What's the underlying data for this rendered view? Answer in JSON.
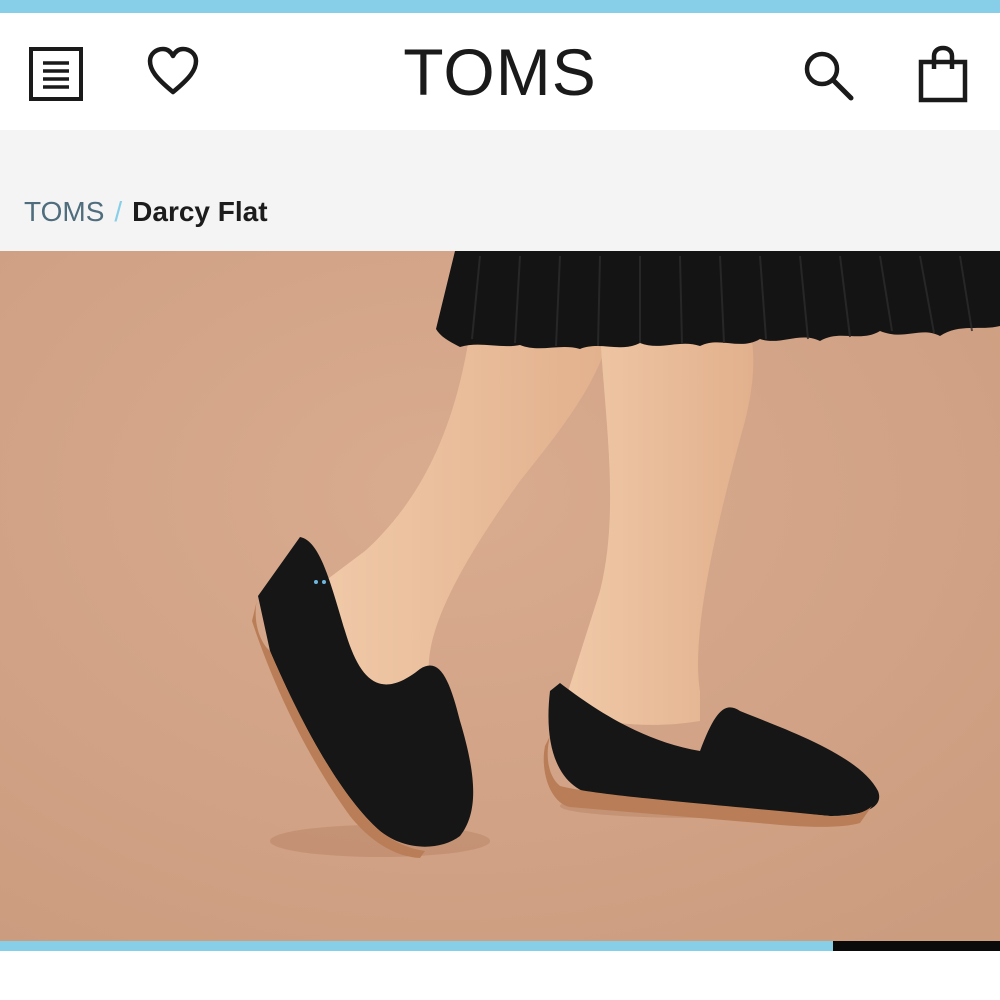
{
  "header": {
    "brand": "TOMS",
    "icons": {
      "menu": "menu-list-icon",
      "wishlist": "heart-icon",
      "search": "search-icon",
      "bag": "shopping-bag-icon"
    }
  },
  "breadcrumb": {
    "home": "TOMS",
    "separator": "/",
    "current": "Darcy Flat"
  },
  "hero": {
    "image": "Woman wearing black Darcy Flat shoes on a tan background"
  },
  "gallery": {
    "progress": 0.833
  },
  "colors": {
    "accent": "#87cfe9",
    "hero_background": "#d7a688",
    "text_dark": "#1a1a1a",
    "breadcrumb_link": "#4f6d7d"
  }
}
